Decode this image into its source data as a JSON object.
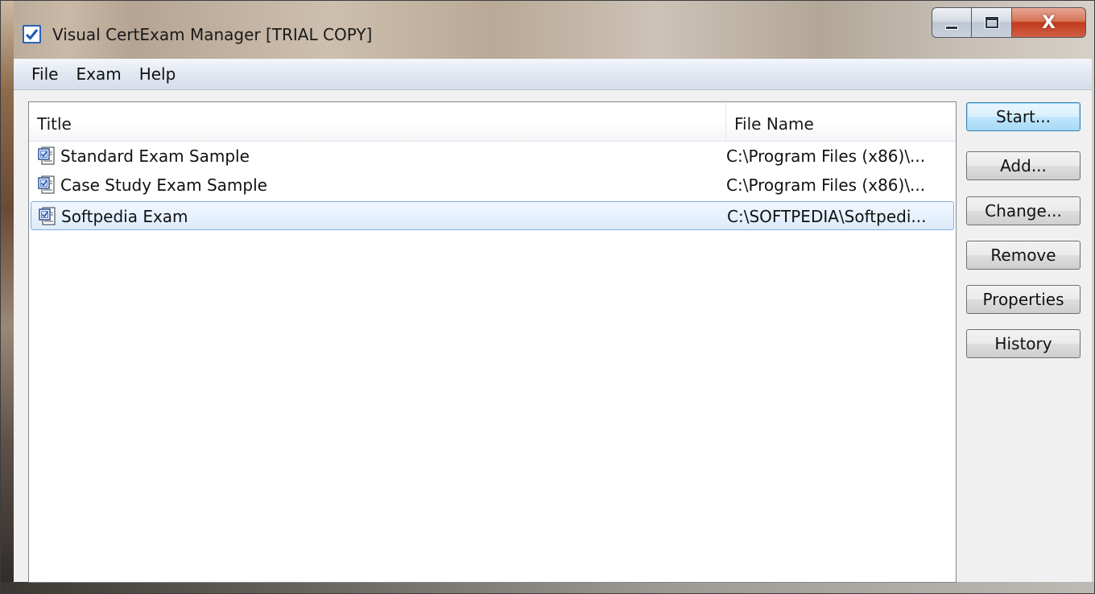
{
  "window": {
    "title": "Visual CertExam Manager [TRIAL COPY]"
  },
  "menu": {
    "items": [
      "File",
      "Exam",
      "Help"
    ]
  },
  "list": {
    "columns": {
      "title": "Title",
      "file_name": "File Name"
    },
    "rows": [
      {
        "title": "Standard Exam Sample",
        "file_name": "C:\\Program Files (x86)\\...",
        "selected": false,
        "icon": "exam-document-icon"
      },
      {
        "title": "Case Study Exam Sample",
        "file_name": "C:\\Program Files (x86)\\...",
        "selected": false,
        "icon": "exam-document-icon"
      },
      {
        "title": "Softpedia Exam",
        "file_name": "C:\\SOFTPEDIA\\Softpedi...",
        "selected": true,
        "icon": "exam-document-icon"
      }
    ]
  },
  "buttons": {
    "start": "Start...",
    "add": "Add...",
    "change": "Change...",
    "remove": "Remove",
    "properties": "Properties",
    "history": "History"
  },
  "caption_buttons": {
    "close_glyph": "X"
  },
  "colors": {
    "selection_bg": "#dcebfc",
    "selection_border": "#84acdd",
    "default_button_border": "#3c7fb1",
    "close_button": "#c2391a"
  }
}
